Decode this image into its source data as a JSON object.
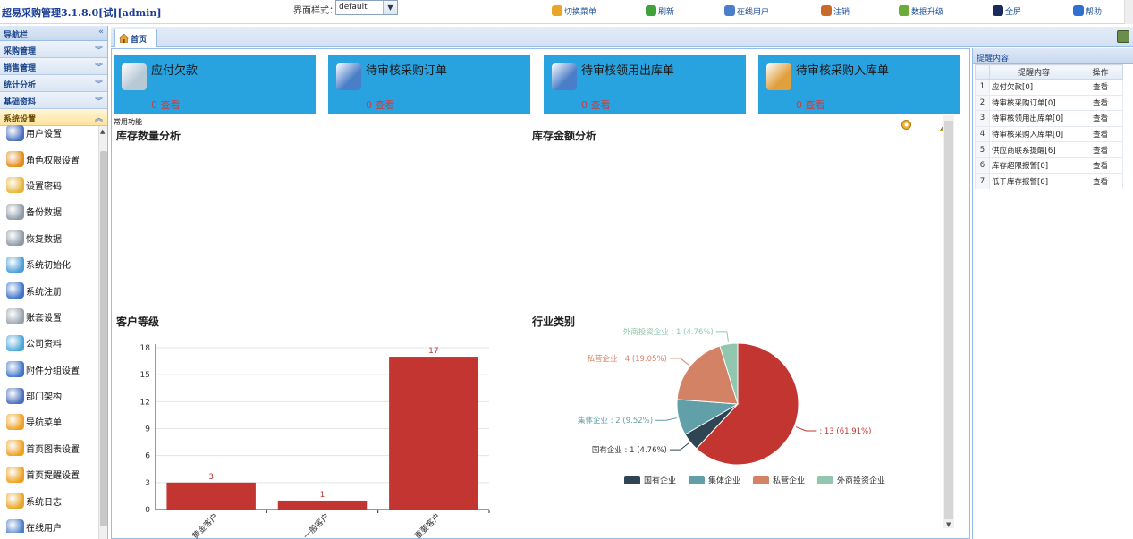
{
  "app": {
    "title": "超易采购管理3.1.8.0[试][admin]",
    "style_label": "界面样式：",
    "style_value": "default"
  },
  "toolbar": [
    {
      "label": "切换菜单",
      "icon": "switch-menu-icon",
      "color": "#e8a628"
    },
    {
      "label": "刷新",
      "icon": "refresh-icon",
      "color": "#3fa33a"
    },
    {
      "label": "在线用户",
      "icon": "online-users-icon",
      "color": "#4a7ec8"
    },
    {
      "label": "注销",
      "icon": "logout-icon",
      "color": "#c96a2a"
    },
    {
      "label": "数据升级",
      "icon": "data-upgrade-icon",
      "color": "#6aab3a"
    },
    {
      "label": "全屏",
      "icon": "fullscreen-icon",
      "color": "#1a2a5a"
    },
    {
      "label": "帮助",
      "icon": "help-icon",
      "color": "#2f6fd0"
    }
  ],
  "nav": {
    "header": "导航栏",
    "sections": [
      {
        "label": "采购管理",
        "active": false
      },
      {
        "label": "销售管理",
        "active": false
      },
      {
        "label": "统计分析",
        "active": false
      },
      {
        "label": "基础资料",
        "active": false
      },
      {
        "label": "系统设置",
        "active": true
      }
    ],
    "items": [
      {
        "label": "用户设置",
        "icon": "user-settings-icon",
        "color": "#4a6fbf"
      },
      {
        "label": "角色权限设置",
        "icon": "role-permission-icon",
        "color": "#e38b1c"
      },
      {
        "label": "设置密码",
        "icon": "key-icon",
        "color": "#e8b53a"
      },
      {
        "label": "备份数据",
        "icon": "backup-database-icon",
        "color": "#8f9aa8"
      },
      {
        "label": "恢复数据",
        "icon": "restore-database-icon",
        "color": "#8f9aa8"
      },
      {
        "label": "系统初始化",
        "icon": "system-init-icon",
        "color": "#4a9fd8"
      },
      {
        "label": "系统注册",
        "icon": "register-icon",
        "color": "#3f76c9"
      },
      {
        "label": "账套设置",
        "icon": "tools-icon",
        "color": "#9aa3ad"
      },
      {
        "label": "公司资料",
        "icon": "company-info-icon",
        "color": "#4aa8d8"
      },
      {
        "label": "附件分组设置",
        "icon": "attachment-group-icon",
        "color": "#3f76c9"
      },
      {
        "label": "部门架构",
        "icon": "department-icon",
        "color": "#4a6fbf"
      },
      {
        "label": "导航菜单",
        "icon": "nav-menu-icon",
        "color": "#f0a020"
      },
      {
        "label": "首页图表设置",
        "icon": "home-chart-settings-icon",
        "color": "#f0a020"
      },
      {
        "label": "首页提醒设置",
        "icon": "home-reminder-settings-icon",
        "color": "#f0a020"
      },
      {
        "label": "系统日志",
        "icon": "system-log-icon",
        "color": "#e8a628"
      },
      {
        "label": "在线用户",
        "icon": "online-users-icon",
        "color": "#4a7ec8"
      }
    ]
  },
  "tabs": {
    "home": "首页"
  },
  "cards": [
    {
      "title": "应付欠款",
      "count": "0 查看",
      "icon": "payables-icon"
    },
    {
      "title": "待审核采购订单",
      "count": "0 查看",
      "icon": "purchase-order-icon"
    },
    {
      "title": "待审核领用出库单",
      "count": "0 查看",
      "icon": "outbound-order-icon"
    },
    {
      "title": "待审核采购入库单",
      "count": "0 查看",
      "icon": "inbound-order-icon"
    }
  ],
  "common_label": "常用功能",
  "sections": {
    "stock_qty": "库存数量分析",
    "stock_amount": "库存金额分析",
    "customer_level": "客户等级",
    "industry": "行业类别"
  },
  "chart_data": [
    {
      "type": "bar",
      "title": "客户等级",
      "categories": [
        "黄金客户",
        "一般客户",
        "重要客户"
      ],
      "values": [
        3,
        1,
        17
      ],
      "ylim": [
        0,
        18
      ],
      "yticks": [
        0,
        3,
        6,
        9,
        12,
        15,
        18
      ],
      "grid": true,
      "bar_color": "#c23531"
    },
    {
      "type": "pie",
      "title": "行业类别",
      "slices": [
        {
          "name": "国有企业",
          "value": 1,
          "label": "国有企业 : 1 (4.76%)",
          "color": "#2f4554"
        },
        {
          "name": "集体企业",
          "value": 2,
          "label": "集体企业 : 2 (9.52%)",
          "color": "#61a0a8"
        },
        {
          "name": "私营企业",
          "value": 4,
          "label": "私营企业 : 4 (19.05%)",
          "color": "#d48265"
        },
        {
          "name": "外商投资企业",
          "value": 1,
          "label": "外商投资企业 : 1 (4.76%)",
          "color": "#91c7ae"
        },
        {
          "name": "",
          "value": 13,
          "label": ": 13 (61.91%)",
          "color": "#c23531"
        }
      ],
      "legend": [
        "国有企业",
        "集体企业",
        "私营企业",
        "外商投资企业"
      ],
      "legend_position": "bottom"
    }
  ],
  "right_panel": {
    "title": "提醒内容",
    "columns": [
      "提醒内容",
      "操作"
    ],
    "rows": [
      {
        "num": "1",
        "content": "应付欠款[0]",
        "op": "查看"
      },
      {
        "num": "2",
        "content": "待审核采购订单[0]",
        "op": "查看"
      },
      {
        "num": "3",
        "content": "待审核领用出库单[0]",
        "op": "查看"
      },
      {
        "num": "4",
        "content": "待审核采购入库单[0]",
        "op": "查看"
      },
      {
        "num": "5",
        "content": "供应商联系提醒[6]",
        "op": "查看"
      },
      {
        "num": "6",
        "content": "库存超限报警[0]",
        "op": "查看"
      },
      {
        "num": "7",
        "content": "低于库存报警[0]",
        "op": "查看"
      }
    ]
  }
}
